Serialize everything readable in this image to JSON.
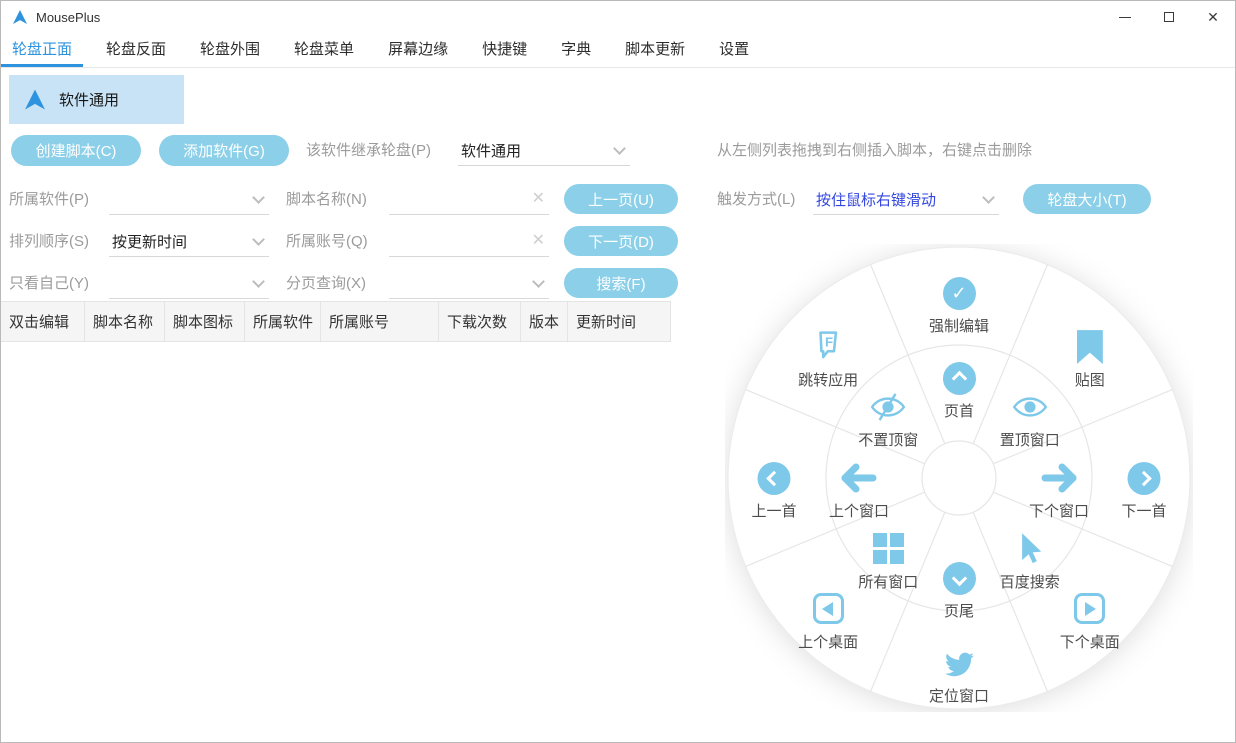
{
  "colors": {
    "accent": "#2E93DE",
    "icon_blue": "#7EC8EA",
    "button_blue": "#8CCFE8",
    "selected_bg": "#C9E3F6",
    "trigger_value_blue": "#3246E0"
  },
  "window": {
    "title": "MousePlus"
  },
  "tabs": [
    {
      "name": "wheel-front",
      "label": "轮盘正面",
      "active": true
    },
    {
      "name": "wheel-back",
      "label": "轮盘反面",
      "active": false
    },
    {
      "name": "wheel-outer",
      "label": "轮盘外围",
      "active": false
    },
    {
      "name": "wheel-menu",
      "label": "轮盘菜单",
      "active": false
    },
    {
      "name": "screen-edge",
      "label": "屏幕边缘",
      "active": false
    },
    {
      "name": "hotkeys",
      "label": "快捷键",
      "active": false
    },
    {
      "name": "dictionary",
      "label": "字典",
      "active": false
    },
    {
      "name": "script-update",
      "label": "脚本更新",
      "active": false
    },
    {
      "name": "settings",
      "label": "设置",
      "active": false
    }
  ],
  "software_list": {
    "selected": "软件通用"
  },
  "toolbar": {
    "create_script": "创建脚本(C)",
    "add_software": "添加软件(G)",
    "inherit_label": "该软件继承轮盘(P)",
    "inherit_value": "软件通用",
    "drag_hint": "从左侧列表拖拽到右侧插入脚本，右键点击删除"
  },
  "filters": {
    "software_label": "所属软件(P)",
    "software_value": "",
    "script_name_label": "脚本名称(N)",
    "script_name_value": "",
    "order_label": "排列顺序(S)",
    "order_value": "按更新时间",
    "account_label": "所属账号(Q)",
    "account_value": "",
    "only_mine_label": "只看自己(Y)",
    "only_mine_value": "",
    "paging_label": "分页查询(X)",
    "paging_value": ""
  },
  "pager": {
    "prev_button": "上一页(U)",
    "next_button": "下一页(D)",
    "search_button": "搜索(F)"
  },
  "trigger": {
    "label": "触发方式(L)",
    "value": "按住鼠标右键滑动",
    "wheel_size_button": "轮盘大小(T)"
  },
  "table": {
    "columns": [
      {
        "name": "dblclick-edit",
        "label": "双击编辑"
      },
      {
        "name": "script-name",
        "label": "脚本名称"
      },
      {
        "name": "script-icon",
        "label": "脚本图标"
      },
      {
        "name": "owner-software",
        "label": "所属软件"
      },
      {
        "name": "owner-account",
        "label": "所属账号"
      },
      {
        "name": "downloads",
        "label": "下载次数"
      },
      {
        "name": "version",
        "label": "版本"
      },
      {
        "name": "update-time",
        "label": "更新时间"
      }
    ],
    "rows": []
  },
  "wheel": {
    "inner": [
      {
        "name": "page-top",
        "label": "页首",
        "icon": "chevron-up-circle-icon",
        "angle": -90
      },
      {
        "name": "pin-window",
        "label": "置顶窗口",
        "icon": "eye-icon",
        "angle": -45
      },
      {
        "name": "next-window",
        "label": "下个窗口",
        "icon": "arrow-right-icon",
        "angle": 0
      },
      {
        "name": "baidu-search",
        "label": "百度搜索",
        "icon": "cursor-icon",
        "angle": 45
      },
      {
        "name": "page-bottom",
        "label": "页尾",
        "icon": "chevron-down-circle-icon",
        "angle": 90
      },
      {
        "name": "all-windows",
        "label": "所有窗口",
        "icon": "windows-icon",
        "angle": 135
      },
      {
        "name": "prev-window",
        "label": "上个窗口",
        "icon": "arrow-left-icon",
        "angle": 180
      },
      {
        "name": "unpin-window",
        "label": "不置顶窗",
        "icon": "eye-slash-icon",
        "angle": -135
      }
    ],
    "outer": [
      {
        "name": "force-edit",
        "label": "强制编辑",
        "icon": "check-circle-icon",
        "angle": -90
      },
      {
        "name": "screenshot-pin",
        "label": "贴图",
        "icon": "bookmark-icon",
        "angle": -45
      },
      {
        "name": "next-song",
        "label": "下一首",
        "icon": "chevron-right-circle-icon",
        "angle": 0
      },
      {
        "name": "next-desktop",
        "label": "下个桌面",
        "icon": "play-square-right-icon",
        "angle": 45
      },
      {
        "name": "locate-window",
        "label": "定位窗口",
        "icon": "twitter-icon",
        "angle": 90
      },
      {
        "name": "prev-desktop",
        "label": "上个桌面",
        "icon": "play-square-left-icon",
        "angle": 135
      },
      {
        "name": "prev-song",
        "label": "上一首",
        "icon": "chevron-left-circle-icon",
        "angle": 180
      },
      {
        "name": "jump-app",
        "label": "跳转应用",
        "icon": "foursquare-icon",
        "angle": -135
      }
    ]
  }
}
